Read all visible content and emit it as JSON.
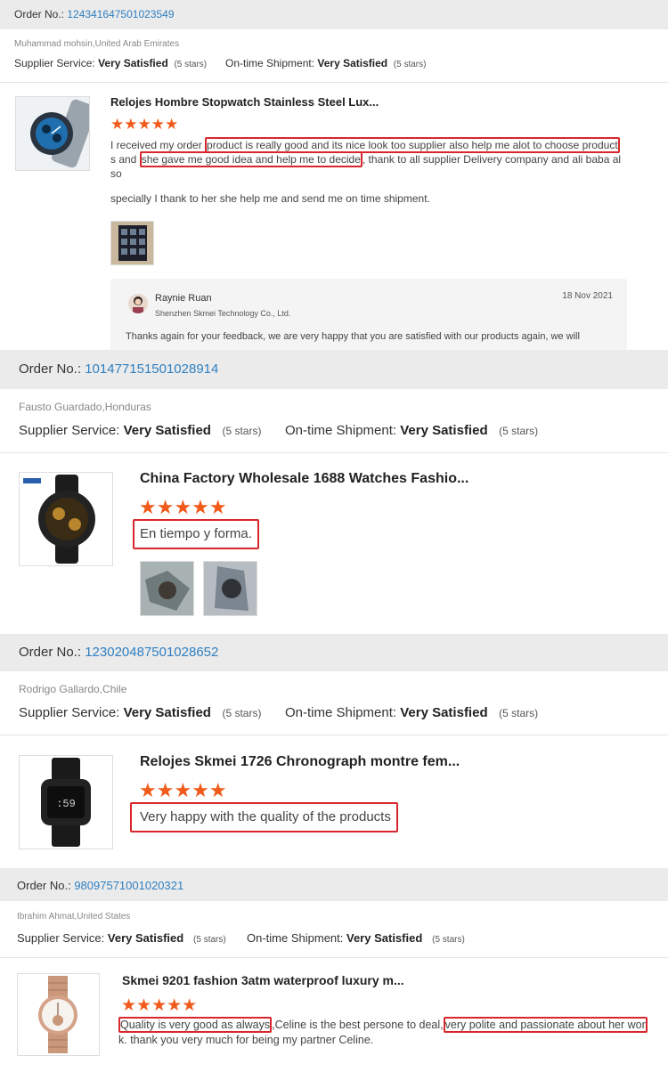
{
  "labels": {
    "order_no": "Order No.:",
    "supplier_service": "Supplier Service:",
    "on_time_shipment": "On-time Shipment:"
  },
  "reviews": [
    {
      "order_number": "124341647501023549",
      "buyer": "Muhammad mohsin,United Arab Emirates",
      "supplier_rating": "Very Satisfied",
      "supplier_stars": "(5 stars)",
      "shipment_rating": "Very Satisfied",
      "shipment_stars": "(5 stars)",
      "product_title": "Relojes Hombre Stopwatch Stainless Steel Lux...",
      "stars": "★★★★★",
      "review_parts": [
        "I received my order ",
        "product is really good and its nice look too supplier also help me alot to choose product",
        " s and ",
        "she gave me good idea and help me to decide",
        ", thank to all supplier Delivery company and ali baba al so"
      ],
      "review_line2": "specially I thank to her she help me and send me on time shipment.",
      "reply": {
        "name": "Raynie Ruan",
        "company": "Shenzhen Skmei Technology Co., Ltd.",
        "date": "18 Nov 2021",
        "text": "Thanks again for your feedback,  we are very happy that you are satisfied with our products again, we will"
      }
    },
    {
      "order_number": "101477151501028914",
      "buyer": "Fausto Guardado,Honduras",
      "supplier_rating": "Very Satisfied",
      "supplier_stars": "(5 stars)",
      "shipment_rating": "Very Satisfied",
      "shipment_stars": "(5 stars)",
      "product_title": "China Factory Wholesale 1688 Watches Fashio...",
      "stars": "★★★★★",
      "review_text": "En tiempo y forma."
    },
    {
      "order_number": "123020487501028652",
      "buyer": "Rodrigo Gallardo,Chile",
      "supplier_rating": "Very Satisfied",
      "supplier_stars": "(5 stars)",
      "shipment_rating": "Very Satisfied",
      "shipment_stars": "(5 stars)",
      "product_title": "Relojes Skmei 1726 Chronograph montre fem...",
      "stars": "★★★★★",
      "review_text": "Very happy with the quality of the products"
    },
    {
      "order_number": "98097571001020321",
      "buyer": "Ibrahim Ahmat,United States",
      "supplier_rating": "Very Satisfied",
      "supplier_stars": "(5 stars)",
      "shipment_rating": "Very Satisfied",
      "shipment_stars": "(5 stars)",
      "product_title": "Skmei 9201 fashion 3atm waterproof luxury m...",
      "stars": "★★★★★",
      "review_parts": [
        "Quality is very good as always",
        ",Celine is the best persone to deal,",
        "very polite and passionate about her wor",
        "k. thank you very much for being my partner Celine."
      ]
    }
  ],
  "colors": {
    "link": "#2f7fc1",
    "star": "#f05a1a",
    "highlight": "#d9262c"
  }
}
